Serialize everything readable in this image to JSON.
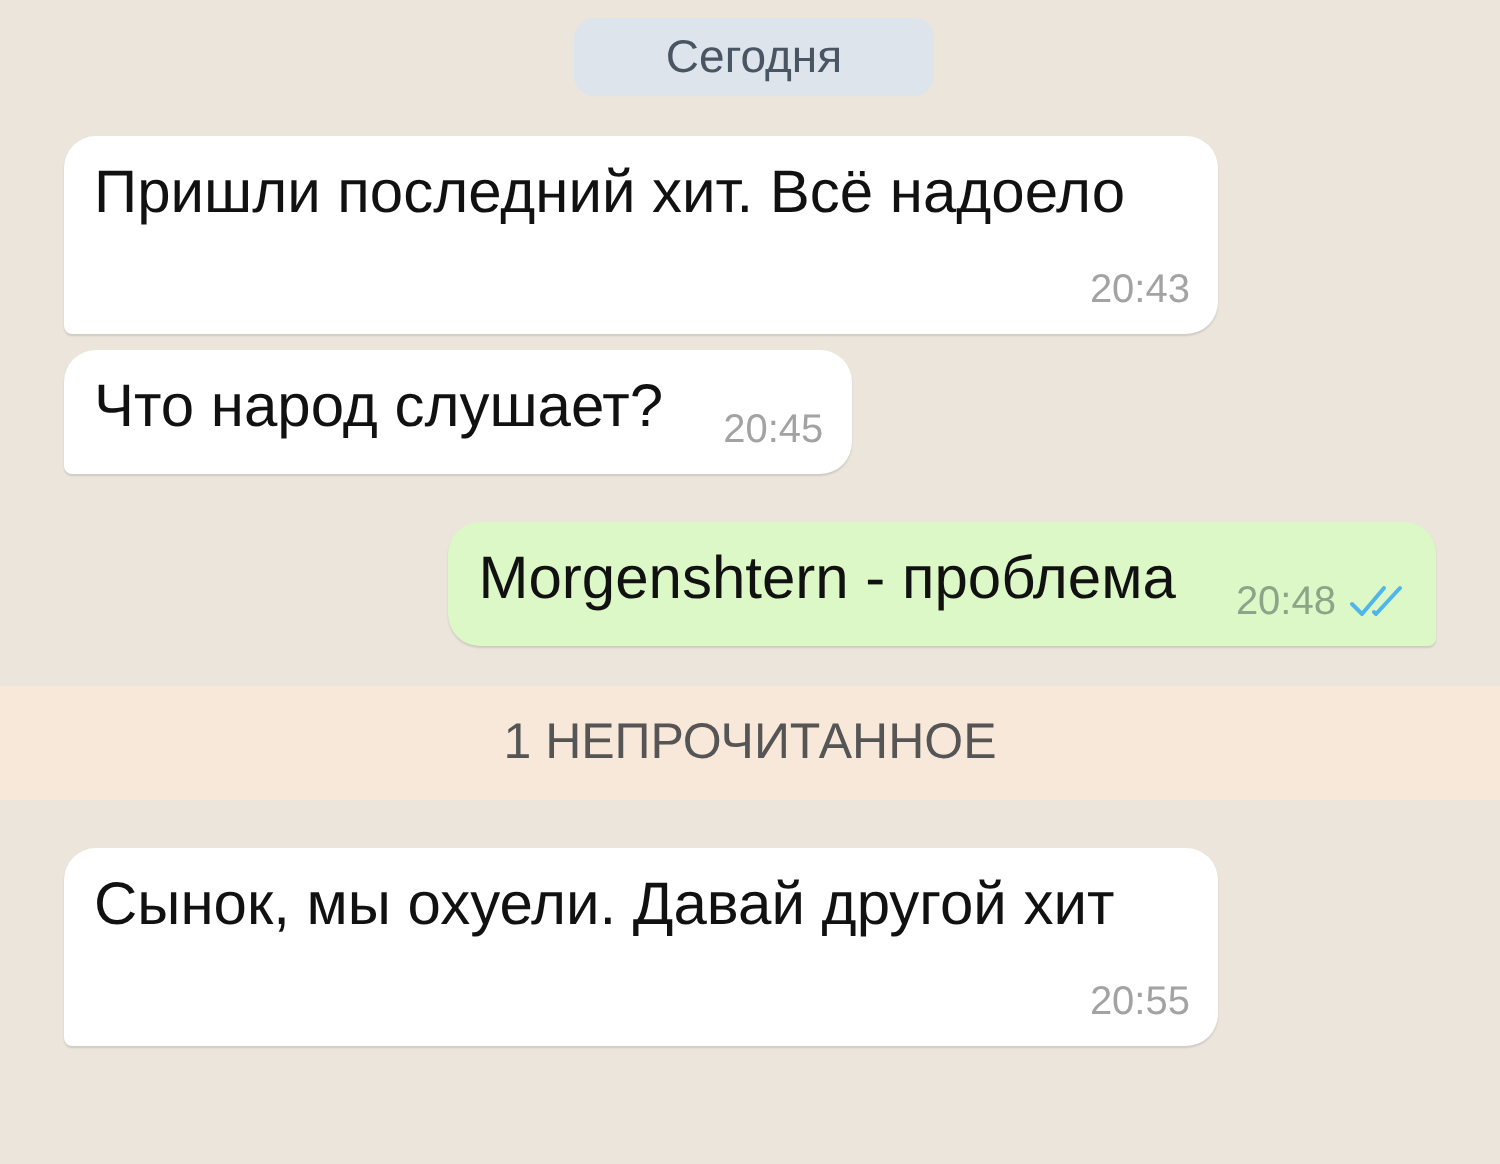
{
  "date_divider": "Сегодня",
  "chat": [
    {
      "kind": "incoming",
      "text": "Пришли последний хит. Всё надоело",
      "time": "20:43"
    },
    {
      "kind": "incoming",
      "text": "Что народ слушает?",
      "time": "20:45"
    },
    {
      "kind": "outgoing",
      "text": "Morgenshtern - проблема",
      "time": "20:48",
      "read": true
    },
    {
      "kind": "unread",
      "text": "1 НЕПРОЧИТАННОЕ"
    },
    {
      "kind": "incoming",
      "text": "Сынок, мы охуели. Давай другой хит",
      "time": "20:55"
    }
  ]
}
